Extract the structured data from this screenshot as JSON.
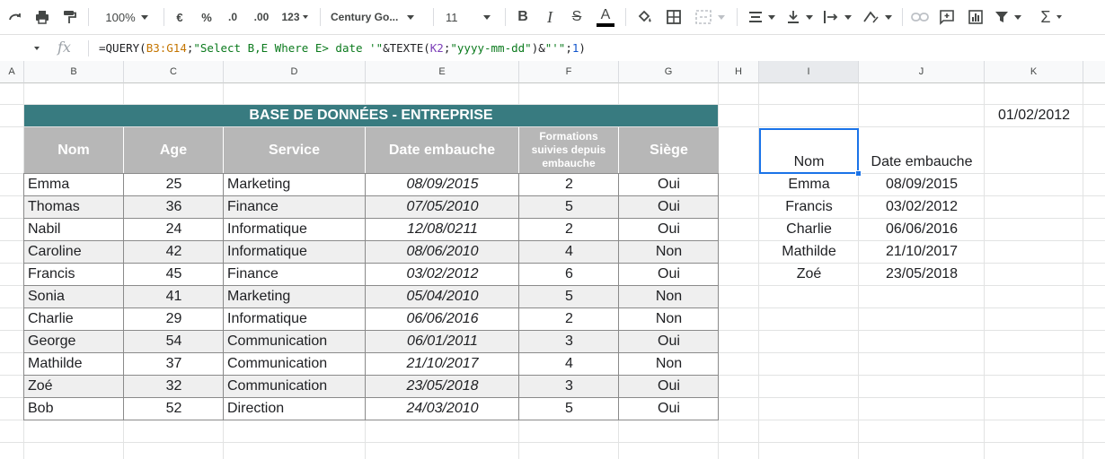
{
  "toolbar": {
    "zoom": "100%",
    "currency": "€",
    "percent": "%",
    "decrease_decimals": ".0",
    "increase_decimals": ".00",
    "number_format": "123",
    "font": "Century Go...",
    "font_size": "11",
    "bold": "B",
    "italic": "I",
    "strike": "S",
    "text_color": "A",
    "sum": "Σ"
  },
  "formula_bar": {
    "fx": "fx",
    "formula": {
      "p1": "=QUERY(",
      "ref1": "B3:G14",
      "p2": ";",
      "str1": "\"Select B,E Where E> date '\"",
      "p3": "&TEXTE(",
      "ref2": "K2",
      "p4": ";",
      "str2": "\"yyyy-mm-dd\"",
      "p5": ")&",
      "str3": "\"'\"",
      "p6": ";",
      "num": "1",
      "p7": ")"
    }
  },
  "columns": [
    "A",
    "B",
    "C",
    "D",
    "E",
    "F",
    "G",
    "H",
    "I",
    "J",
    "K"
  ],
  "database": {
    "title": "BASE DE DONNÉES - ENTREPRISE",
    "headers": [
      "Nom",
      "Age",
      "Service",
      "Date embauche",
      "Formations suivies depuis embauche",
      "Siège"
    ],
    "rows": [
      [
        "Emma",
        "25",
        "Marketing",
        "08/09/2015",
        "2",
        "Oui"
      ],
      [
        "Thomas",
        "36",
        "Finance",
        "07/05/2010",
        "5",
        "Oui"
      ],
      [
        "Nabil",
        "24",
        "Informatique",
        "12/08/0211",
        "2",
        "Oui"
      ],
      [
        "Caroline",
        "42",
        "Informatique",
        "08/06/2010",
        "4",
        "Non"
      ],
      [
        "Francis",
        "45",
        "Finance",
        "03/02/2012",
        "6",
        "Oui"
      ],
      [
        "Sonia",
        "41",
        "Marketing",
        "05/04/2010",
        "5",
        "Non"
      ],
      [
        "Charlie",
        "29",
        "Informatique",
        "06/06/2016",
        "2",
        "Non"
      ],
      [
        "George",
        "54",
        "Communication",
        "06/01/2011",
        "3",
        "Oui"
      ],
      [
        "Mathilde",
        "37",
        "Communication",
        "21/10/2017",
        "4",
        "Non"
      ],
      [
        "Zoé",
        "32",
        "Communication",
        "23/05/2018",
        "3",
        "Oui"
      ],
      [
        "Bob",
        "52",
        "Direction",
        "24/03/2010",
        "5",
        "Oui"
      ]
    ]
  },
  "criteria_date": "01/02/2012",
  "query_result": {
    "headers": [
      "Nom",
      "Date embauche"
    ],
    "rows": [
      [
        "Emma",
        "08/09/2015"
      ],
      [
        "Francis",
        "03/02/2012"
      ],
      [
        "Charlie",
        "06/06/2016"
      ],
      [
        "Mathilde",
        "21/10/2017"
      ],
      [
        "Zoé",
        "23/05/2018"
      ]
    ]
  },
  "colors": {
    "title_bg": "#387b80",
    "header_bg": "#b7b7b7",
    "row_alt_bg": "#efefef",
    "selection": "#1a73e8"
  }
}
